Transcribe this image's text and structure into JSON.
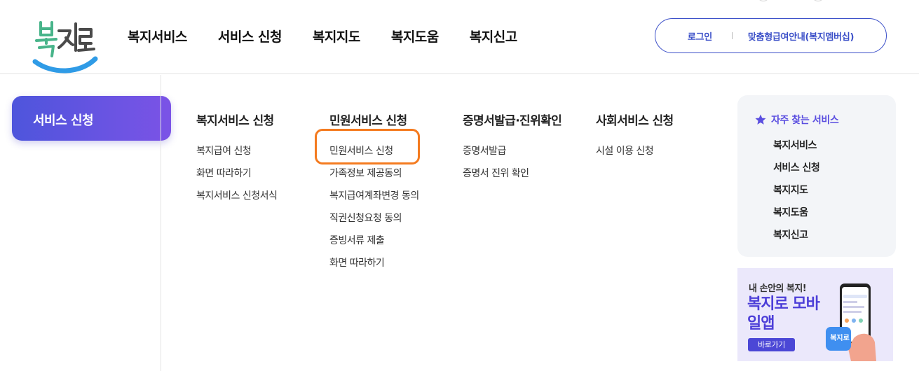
{
  "header": {
    "logo_text": "복지로",
    "gnb": [
      "복지서비스",
      "서비스 신청",
      "복지지도",
      "복지도움",
      "복지신고"
    ],
    "login_label": "로그인",
    "member_label": "맞춤형급여안내(복지멤버십)"
  },
  "sidebar": {
    "active_label": "서비스 신청"
  },
  "menu": {
    "columns": [
      {
        "title": "복지서비스 신청",
        "links": [
          "복지급여 신청",
          "화면 따라하기",
          "복지서비스 신청서식"
        ]
      },
      {
        "title": "민원서비스 신청",
        "links": [
          "민원서비스 신청",
          "가족정보 제공동의",
          "복지급여계좌변경 동의",
          "직권신청요청 동의",
          "증빙서류 제출",
          "화면 따라하기"
        ]
      },
      {
        "title": "증명서발급·진위확인",
        "links": [
          "증명서발급",
          "증명서 진위 확인"
        ]
      },
      {
        "title": "사회서비스 신청",
        "links": [
          "시설 이용 신청"
        ]
      }
    ]
  },
  "favorites": {
    "title": "자주 찾는 서비스",
    "items": [
      "복지서비스",
      "서비스 신청",
      "복지지도",
      "복지도움",
      "복지신고"
    ]
  },
  "banner": {
    "subtitle": "내 손안의 복지!",
    "title": "복지로 모바일앱",
    "button_label": "바로가기",
    "app_icon_text": "복지로"
  },
  "colors": {
    "brand_blue": "#3b4fc8",
    "purple": "#5a4ee0",
    "logo_green": "#48b48a",
    "logo_blue": "#2f9be6",
    "highlight_orange": "#f47b20"
  }
}
